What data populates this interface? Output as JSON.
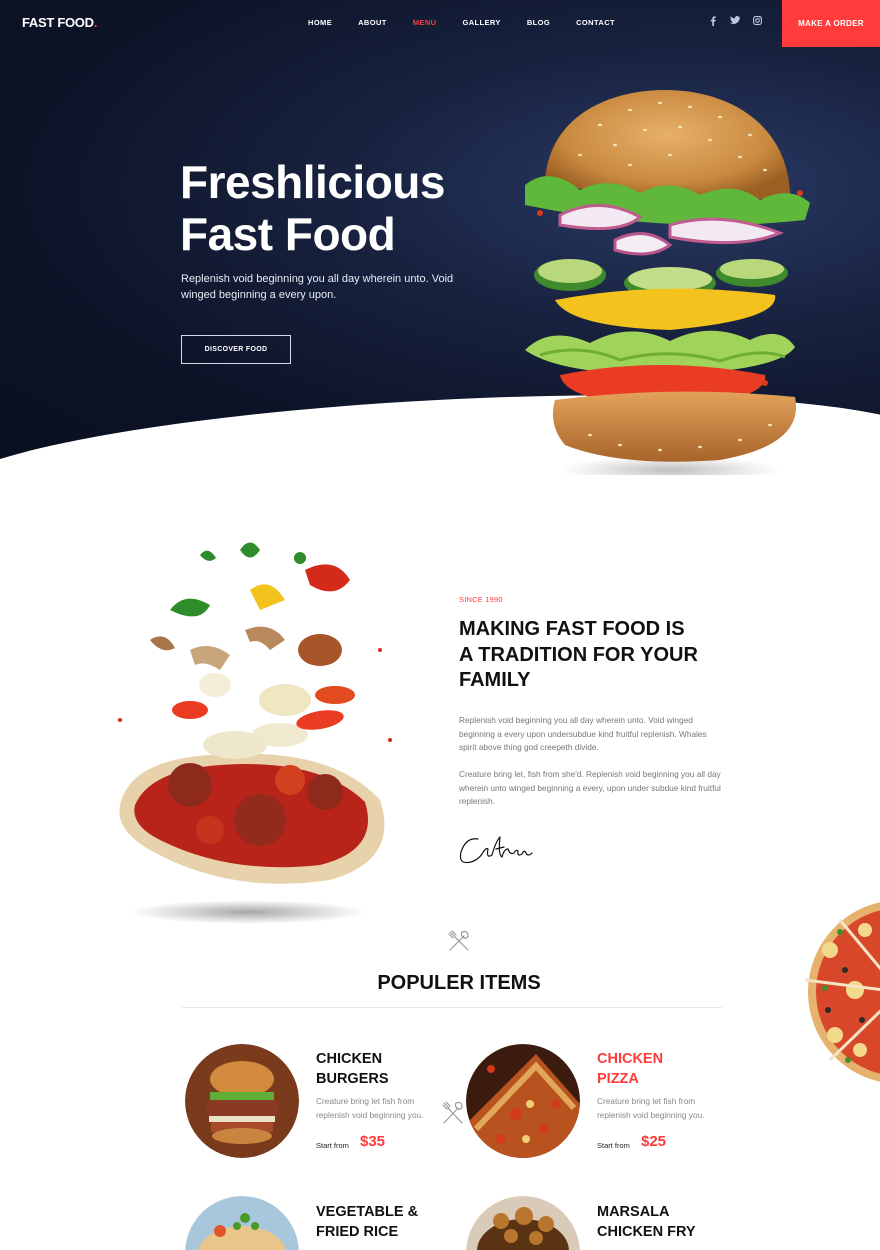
{
  "nav": {
    "logo": "FAST FOOD",
    "logo_dot": ".",
    "links": [
      "HOME",
      "ABOUT",
      "MENU",
      "GALLERY",
      "BLOG",
      "CONTACT"
    ],
    "active": "MENU",
    "socials": [
      "facebook-icon",
      "twitter-icon",
      "instagram-icon"
    ],
    "order_button": "MAKE A ORDER"
  },
  "hero": {
    "title_line1": "Freshlicious",
    "title_line2": "Fast Food",
    "text": "Replenish void beginning you all day wherein unto. Void winged beginning a every upon.",
    "button": "DISCOVER FOOD"
  },
  "about": {
    "eyebrow": "SINCE 1990",
    "title_line1": "MAKING FAST FOOD IS",
    "title_line2": "A TRADITION FOR YOUR",
    "title_line3": "FAMILY",
    "para1": "Replenish void beginning you all day wherein unto. Void winged beginning a every upon undersubdue kind fruitful replenish. Whales spirit above thing god creepeth divide.",
    "para2": "Creature bring let, fish from she'd. Replenish void beginning you all day wherein unto winged beginning a every, upon under subdue kind fruitful replenish.",
    "signature": "Catherine"
  },
  "popular": {
    "title": "POPULER ITEMS",
    "items": [
      {
        "name_line1": "CHICKEN",
        "name_line2": "BURGERS",
        "desc": "Creature bring let fish from replenish void beginning you.",
        "from": "Start from",
        "price": "$35",
        "highlight": false
      },
      {
        "name_line1": "CHICKEN",
        "name_line2": "PIZZA",
        "desc": "Creature bring let fish from replenish void beginning you.",
        "from": "Start from",
        "price": "$25",
        "highlight": true
      },
      {
        "name_line1": "VEGETABLE &",
        "name_line2": "FRIED RICE"
      },
      {
        "name_line1": "MARSALA",
        "name_line2": "CHICKEN FRY"
      }
    ]
  },
  "colors": {
    "accent": "#ff3b3b",
    "hero_bg": "#0d1327",
    "text_dark": "#111111"
  }
}
